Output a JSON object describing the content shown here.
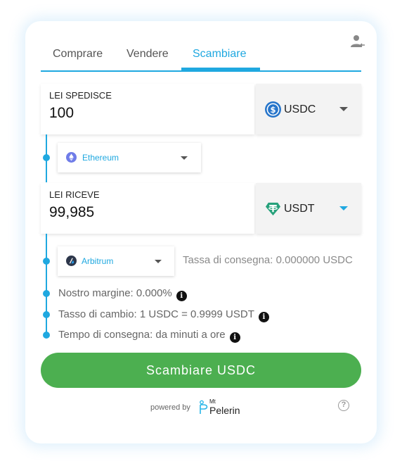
{
  "tabs": [
    {
      "label": "Comprare"
    },
    {
      "label": "Vendere"
    },
    {
      "label": "Scambiare"
    }
  ],
  "send": {
    "label": "LEI SPEDISCE",
    "amount": "100",
    "token": "USDC",
    "token_icon": "usdc-coin-icon",
    "network": "Ethereum",
    "network_icon": "ethereum-icon"
  },
  "receive": {
    "label": "LEI RICEVE",
    "amount": "99,985",
    "token": "USDT",
    "token_icon": "tether-coin-icon",
    "network": "Arbitrum",
    "network_icon": "arbitrum-icon"
  },
  "fee": {
    "text": "Tassa di consegna: 0.000000 USDC"
  },
  "info": [
    {
      "text": "Nostro margine: 0.000%"
    },
    {
      "text": "Tasso di cambio: 1 USDC = 0.9999 USDT"
    },
    {
      "text": "Tempo di consegna: da minuti a ore"
    }
  ],
  "action": {
    "label": "Scambiare USDC"
  },
  "footer": {
    "powered": "powered by",
    "brand_small": "Mt",
    "brand_name": "Pelerin"
  },
  "colors": {
    "accent": "#1fa8e0",
    "button": "#4caf50",
    "usdc": "#2775ca",
    "usdt": "#26a17b"
  }
}
